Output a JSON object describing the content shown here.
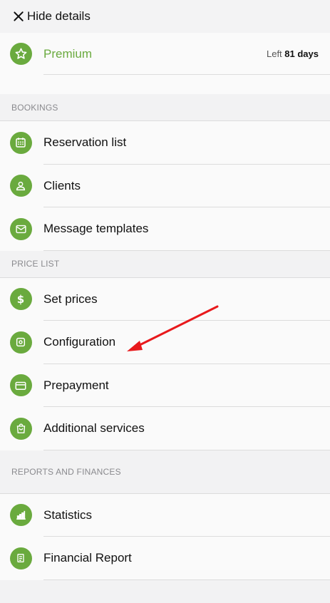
{
  "topbar": {
    "close_icon": "close-icon",
    "label": "Hide details"
  },
  "premium": {
    "label": "Premium",
    "left_word": "Left",
    "days": "81 days",
    "icon": "star-icon"
  },
  "sections": {
    "bookings": {
      "header": "BOOKINGS",
      "items": [
        {
          "label": "Reservation list",
          "icon": "calendar-icon"
        },
        {
          "label": "Clients",
          "icon": "person-icon"
        },
        {
          "label": "Message templates",
          "icon": "envelope-icon"
        }
      ]
    },
    "price_list": {
      "header": "PRICE LIST",
      "items": [
        {
          "label": "Set prices",
          "icon": "dollar-icon"
        },
        {
          "label": "Configuration",
          "icon": "config-icon"
        },
        {
          "label": "Prepayment",
          "icon": "card-icon"
        },
        {
          "label": "Additional services",
          "icon": "bag-icon"
        }
      ]
    },
    "reports": {
      "header": "REPORTS AND FINANCES",
      "items": [
        {
          "label": "Statistics",
          "icon": "bar-chart-icon"
        },
        {
          "label": "Financial Report",
          "icon": "report-icon"
        }
      ]
    }
  },
  "colors": {
    "accent_green": "#6aaa3e",
    "annotation_red": "#e8191c"
  }
}
